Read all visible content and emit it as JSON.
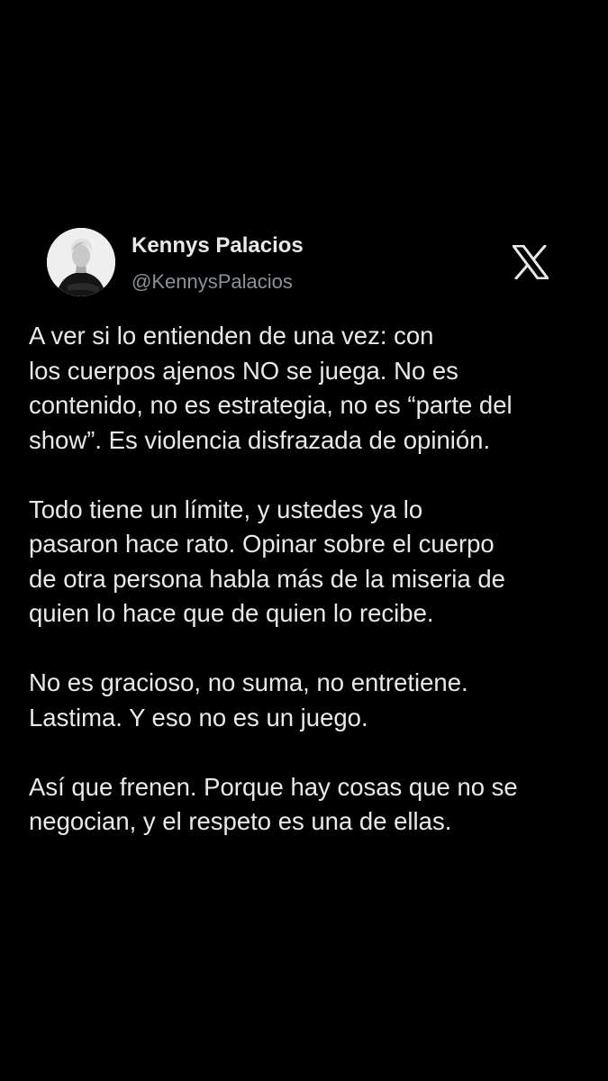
{
  "author": {
    "name": "Kennys Palacios",
    "handle": "@KennysPalacios",
    "avatar_icon": "profile-photo"
  },
  "platform_icon": "x-logo-icon",
  "colors": {
    "background": "#000000",
    "text": "#e7e9ea",
    "secondary_text": "#8b9198"
  },
  "post": {
    "paragraphs": [
      {
        "lines": [
          "A ver si lo entienden de una vez: con",
          "los cuerpos ajenos NO se juega. No es",
          "contenido, no es estrategia, no es “parte del",
          "show”. Es violencia disfrazada de opinión."
        ]
      },
      {
        "lines": [
          "Todo tiene un límite, y ustedes ya lo",
          "pasaron hace rato. Opinar sobre el cuerpo",
          "de otra persona habla más de la miseria de",
          "quien lo hace que de quien lo recibe."
        ]
      },
      {
        "lines": [
          "No es gracioso, no suma, no entretiene.",
          "Lastima. Y eso no es un juego."
        ]
      },
      {
        "lines": [
          "Así que frenen. Porque hay cosas que no se",
          "negocian, y el respeto es una de ellas."
        ]
      }
    ]
  }
}
